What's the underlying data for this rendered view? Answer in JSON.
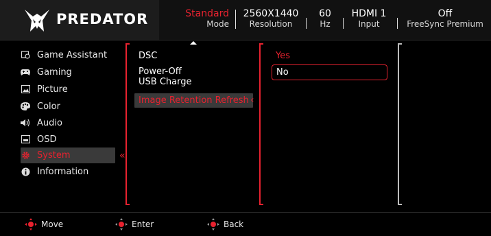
{
  "brand": {
    "name": "PREDATOR"
  },
  "header": {
    "mode": {
      "value": "Standard",
      "label": "Mode"
    },
    "resolution": {
      "value": "2560X1440",
      "label": "Resolution"
    },
    "refresh": {
      "value": "60",
      "label": "Hz"
    },
    "input": {
      "value": "HDMI 1",
      "label": "Input"
    },
    "freesync": {
      "value": "Off",
      "label": "FreeSync Premium"
    }
  },
  "sidebar": {
    "items": [
      {
        "label": "Game Assistant",
        "icon": "game-assistant-icon"
      },
      {
        "label": "Gaming",
        "icon": "gamepad-icon"
      },
      {
        "label": "Picture",
        "icon": "picture-icon"
      },
      {
        "label": "Color",
        "icon": "palette-icon"
      },
      {
        "label": "Audio",
        "icon": "speaker-icon"
      },
      {
        "label": "OSD",
        "icon": "osd-icon"
      },
      {
        "label": "System",
        "icon": "gear-icon",
        "active": true
      },
      {
        "label": "Information",
        "icon": "info-icon"
      }
    ]
  },
  "system_menu": {
    "items": [
      {
        "label": "DSC"
      },
      {
        "label": "Power-Off\nUSB Charge"
      },
      {
        "label": "Image Retention Refresh",
        "active": true
      }
    ]
  },
  "options": {
    "yes": "Yes",
    "no": "No",
    "selected": "No"
  },
  "footer": {
    "move": "Move",
    "enter": "Enter",
    "back": "Back"
  },
  "colors": {
    "accent": "#e8222f",
    "panel": "#3a3a3a",
    "background": "#000000"
  }
}
